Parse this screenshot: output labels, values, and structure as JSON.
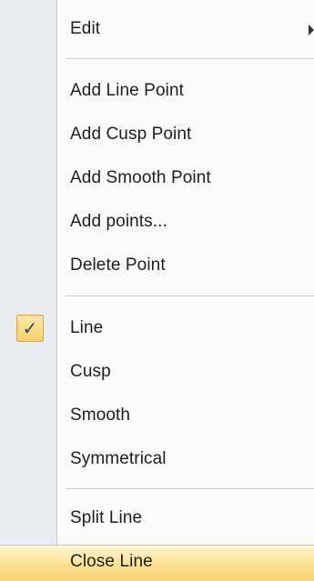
{
  "menu": {
    "items": [
      {
        "label": "Edit"
      },
      {
        "label": "Add Line Point"
      },
      {
        "label": "Add Cusp Point"
      },
      {
        "label": "Add Smooth Point"
      },
      {
        "label": "Add points..."
      },
      {
        "label": "Delete Point"
      },
      {
        "label": "Line",
        "checked": true
      },
      {
        "label": "Cusp"
      },
      {
        "label": "Smooth"
      },
      {
        "label": "Symmetrical"
      },
      {
        "label": "Split Line"
      },
      {
        "label": "Close Line",
        "highlighted": true
      }
    ],
    "check_glyph": "✓",
    "submenu_icon": "chevron-right-icon",
    "colors": {
      "gutter": "#e8edf3",
      "highlight": "#f8d26a",
      "check": "#2a3f8f"
    }
  }
}
